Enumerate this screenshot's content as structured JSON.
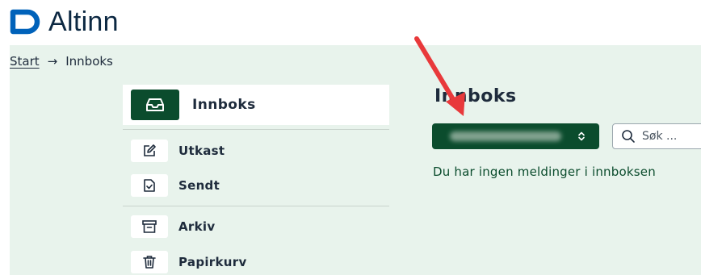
{
  "header": {
    "brand_name": "Altinn",
    "logo_icon": "altinn-logo-icon"
  },
  "breadcrumb": {
    "home_label": "Start",
    "separator": "→",
    "current_label": "Innboks"
  },
  "sidebar": {
    "active_item": {
      "label": "Innboks",
      "icon": "inbox-icon"
    },
    "items": [
      {
        "label": "Utkast",
        "icon": "edit-icon"
      },
      {
        "label": "Sendt",
        "icon": "sent-document-icon"
      },
      {
        "label": "Arkiv",
        "icon": "archive-icon"
      },
      {
        "label": "Papirkurv",
        "icon": "trash-icon"
      }
    ]
  },
  "main": {
    "title": "Innboks",
    "account_selector": {
      "icon": "chevron-up-down-icon"
    },
    "search": {
      "placeholder": "Søk ...",
      "icon": "search-icon"
    },
    "empty_message": "Du har ingen meldinger i innboksen"
  },
  "colors": {
    "accent_dark_green": "#0b4c2d",
    "page_background": "#e8f3ec",
    "brand_navy": "#0c2842",
    "annotation_red": "#e8393b"
  }
}
